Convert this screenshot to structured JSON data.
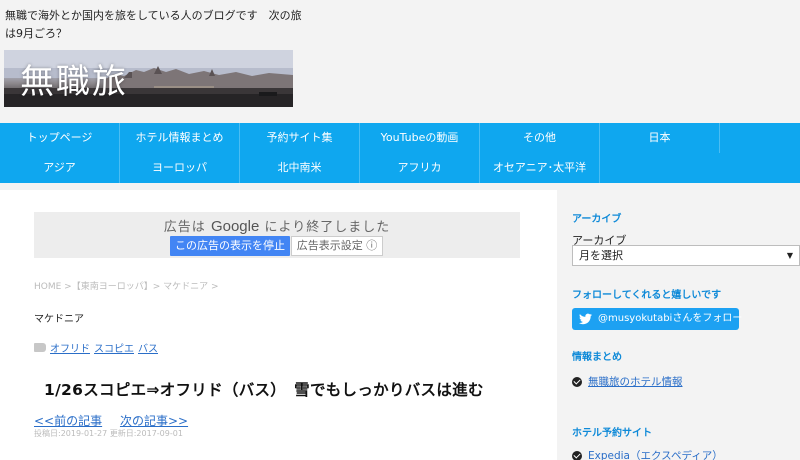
{
  "header": {
    "description": "無職で海外とか国内を旅をしている人のブログです　次の旅は9月ごろ？",
    "logo_text": "無職旅"
  },
  "nav": {
    "row1": [
      "トップページ",
      "ホテル情報まとめ",
      "予約サイト集",
      "YouTubeの動画",
      "その他",
      "日本"
    ],
    "row2": [
      "アジア",
      "ヨーロッパ",
      "北中南米",
      "アフリカ",
      "オセアニア･太平洋"
    ]
  },
  "ad": {
    "message_prefix": "広告は",
    "message_brand": "Google",
    "message_suffix": "により終了しました",
    "stop_button": "この広告の表示を停止",
    "settings_button": "広告表示設定 ⓘ"
  },
  "article": {
    "breadcrumb": "HOME >【東南ヨーロッパ】> マケドニア >",
    "category": "マケドニア",
    "tags": [
      "オフリド",
      "スコピエ",
      "バス"
    ],
    "title": "1/26スコピエ⇒オフリド（バス）　雪でもしっかりバスは進む",
    "prev_link": "<<前の記事",
    "next_link": "次の記事>>",
    "dates": "投稿日:2019-01-27 更新日:2017-09-01"
  },
  "sidebar": {
    "archive_heading": "アーカイブ",
    "archive_label": "アーカイブ",
    "archive_select": "月を選択",
    "follow_heading": "フォローしてくれると嬉しいです",
    "follow_button": "@musyokutabiさんをフォロー",
    "info_heading": "情報まとめ",
    "info_link": "無職旅のホテル情報",
    "hotel_heading": "ホテル予約サイト",
    "hotel_link": "Expedia（エクスペディア）"
  },
  "colors": {
    "nav_bg": "#0fa7ef",
    "link": "#2a6ec8",
    "sidebar_heading": "#0f8ad8",
    "twitter": "#1da1f2",
    "ad_button": "#4285f4"
  }
}
